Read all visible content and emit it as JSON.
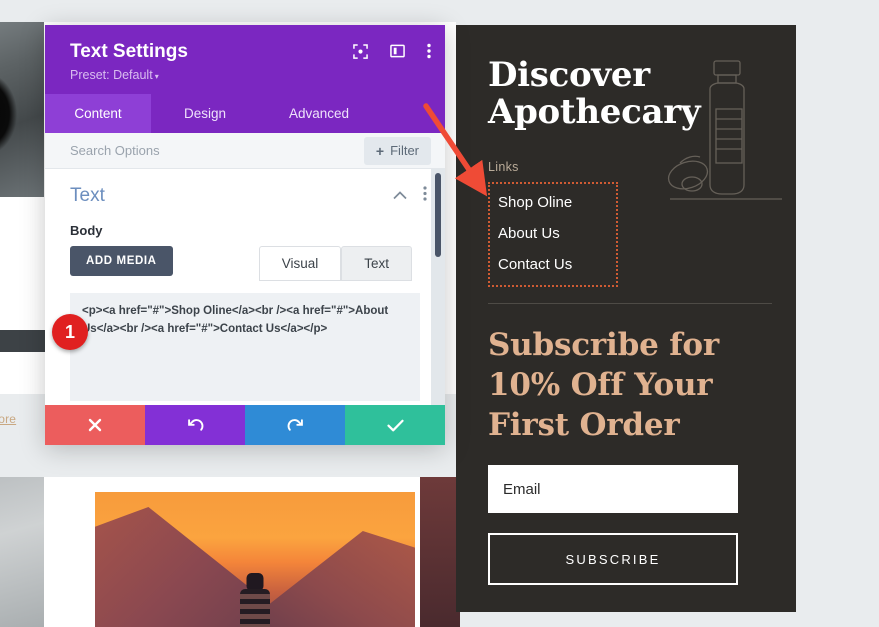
{
  "modal": {
    "title": "Text Settings",
    "preset": "Preset: Default",
    "preset_caret": "▾",
    "header_icons": [
      {
        "name": "focus-icon",
        "label": "focus"
      },
      {
        "name": "layout-panel-icon",
        "label": "layout"
      },
      {
        "name": "more-vertical-icon",
        "label": "more"
      }
    ],
    "tabs": [
      {
        "label": "Content",
        "active": true
      },
      {
        "label": "Design",
        "active": false
      },
      {
        "label": "Advanced",
        "active": false
      }
    ],
    "search": {
      "placeholder": "Search Options",
      "filter_label": "Filter",
      "filter_plus": "+"
    },
    "section": {
      "title": "Text",
      "collapse_icon": "chevron-up",
      "menu_icon": "more-vertical"
    },
    "field": {
      "label": "Body",
      "add_media_label": "ADD MEDIA",
      "editor_tabs": [
        {
          "label": "Visual",
          "active": false
        },
        {
          "label": "Text",
          "active": true
        }
      ],
      "code": "<p><a href=\"#\">Shop Oline</a><br /><a href=\"#\">About Us</a><br /><a href=\"#\">Contact Us</a></p>"
    },
    "actions": [
      {
        "name": "cancel-button",
        "icon": "close",
        "color": "#ec5d5d"
      },
      {
        "name": "undo-button",
        "icon": "undo",
        "color": "#8330d6"
      },
      {
        "name": "redo-button",
        "icon": "redo",
        "color": "#2f8bd6"
      },
      {
        "name": "save-button",
        "icon": "check",
        "color": "#2fc09b"
      }
    ]
  },
  "site_panel": {
    "heading": "Discover Apothecary",
    "links_label": "Links",
    "links": [
      {
        "label": "Shop Oline"
      },
      {
        "label": "About Us"
      },
      {
        "label": "Contact Us"
      }
    ],
    "subscribe_heading": "Subscribe for 10% Off Your First Order",
    "email_value": "Email",
    "subscribe_button": "SUBSCRIBE",
    "colors": {
      "background": "#2d2b28",
      "heading": "#ffffff",
      "subscribe_heading": "#e0b290",
      "links_label": "#b9ab98",
      "highlight_border": "#cf5b33"
    }
  },
  "background_page": {
    "read_more_link": "more"
  },
  "annotations": {
    "step_badge": "1",
    "badge_color": "#e02020",
    "arrow_color": "#ef4b36"
  }
}
